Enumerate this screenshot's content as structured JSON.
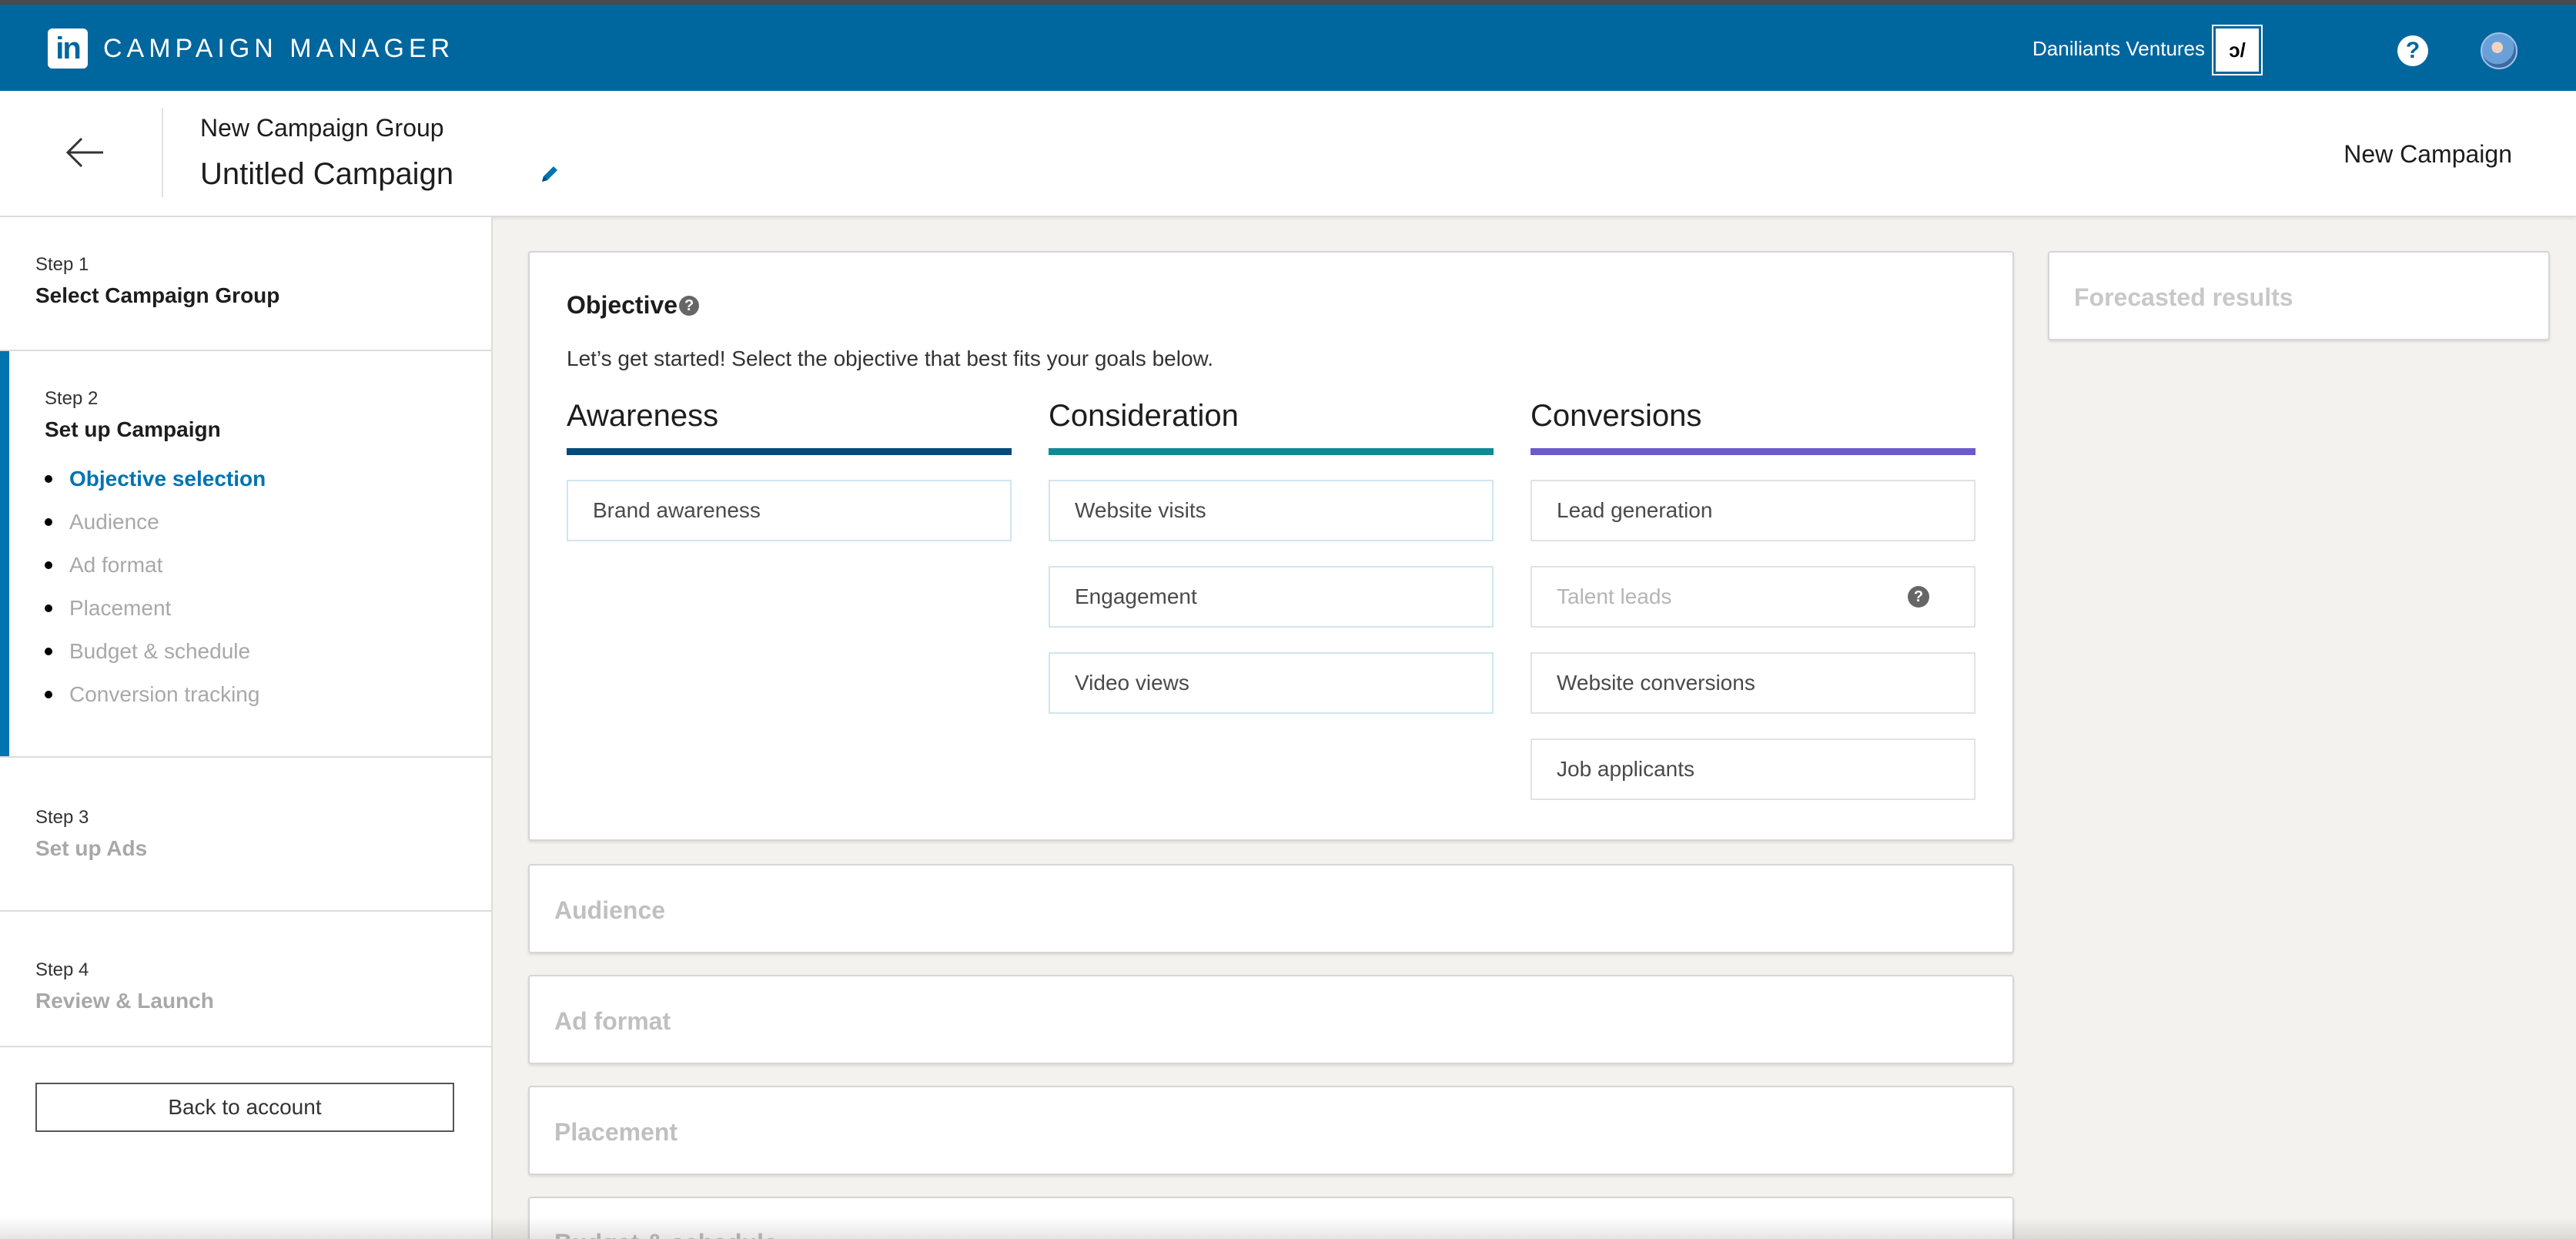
{
  "header": {
    "brand_logo_text": "in",
    "brand_name": "CAMPAIGN MANAGER",
    "account_name": "Daniliants Ventures",
    "account_logo_text": "ↄ/",
    "help_glyph": "?"
  },
  "subheader": {
    "group_title": "New Campaign Group",
    "campaign_name": "Untitled Campaign",
    "right_label": "New Campaign"
  },
  "sidebar": {
    "steps": [
      {
        "num": "Step 1",
        "title": "Select Campaign Group"
      },
      {
        "num": "Step 2",
        "title": "Set up Campaign",
        "substeps": [
          "Objective selection",
          "Audience",
          "Ad format",
          "Placement",
          "Budget & schedule",
          "Conversion tracking"
        ]
      },
      {
        "num": "Step 3",
        "title": "Set up Ads"
      },
      {
        "num": "Step 4",
        "title": "Review & Launch"
      }
    ],
    "back_button": "Back to account"
  },
  "objective": {
    "title": "Objective",
    "help_glyph": "?",
    "subtitle": "Let’s get started! Select the objective that best fits your goals below.",
    "columns": [
      {
        "heading": "Awareness",
        "color": "#004b7c",
        "options": [
          "Brand awareness"
        ]
      },
      {
        "heading": "Consideration",
        "color": "#0e8a94",
        "options": [
          "Website visits",
          "Engagement",
          "Video views"
        ]
      },
      {
        "heading": "Conversions",
        "color": "#6a5acd",
        "options": [
          "Lead generation",
          "Talent leads",
          "Website conversions",
          "Job applicants"
        ]
      }
    ]
  },
  "sections": {
    "audience": "Audience",
    "ad_format": "Ad format",
    "placement": "Placement",
    "budget": "Budget & schedule"
  },
  "forecast": {
    "title": "Forecasted results"
  },
  "colors": {
    "header_blue": "#00669e",
    "active_blue": "#0073b1"
  }
}
